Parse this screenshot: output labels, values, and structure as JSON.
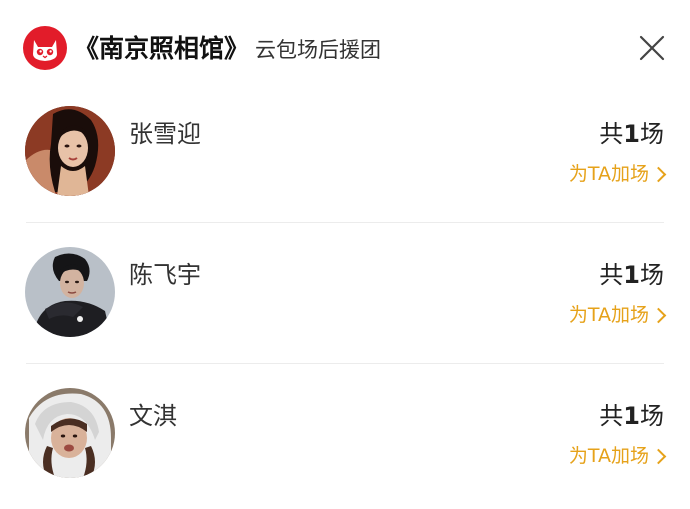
{
  "header": {
    "movie_title": "《南京照相馆》",
    "subtitle": "云包场后援团",
    "logo_icon": "maoyan-cat-logo-icon",
    "close_icon": "close-icon"
  },
  "colors": {
    "accent": "#e6a21a",
    "logo_red": "#e21c2a",
    "divider": "#ececec"
  },
  "supporters": [
    {
      "name": "张雪迎",
      "count_prefix": "共",
      "count": "1",
      "count_suffix": "场",
      "action": "为TA加场"
    },
    {
      "name": "陈飞宇",
      "count_prefix": "共",
      "count": "1",
      "count_suffix": "场",
      "action": "为TA加场"
    },
    {
      "name": "文淇",
      "count_prefix": "共",
      "count": "1",
      "count_suffix": "场",
      "action": "为TA加场"
    }
  ]
}
